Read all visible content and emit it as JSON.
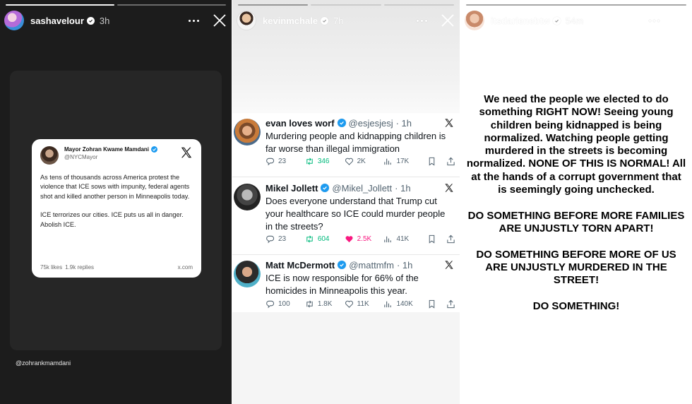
{
  "stories": [
    {
      "username": "sashavelour",
      "time": "3h",
      "embed": {
        "name": "Mayor Zohran Kwame Mamdani",
        "handle": "@NYCMayor",
        "paragraph1": "As tens of thousands across America protest the violence that ICE sows with impunity, federal agents shot and killed another person in Minneapolis today.",
        "paragraph2": "ICE terrorizes our cities. ICE puts us all in danger. Abolish ICE.",
        "likes": "75k likes",
        "replies": "1.9k replies",
        "domain": "x.com"
      },
      "mention": "@zohrankmamdani"
    },
    {
      "username": "kevinmchale",
      "time": "7h",
      "tweets": [
        {
          "name": "evan loves worf",
          "handle": "@esjesjesj",
          "time": "· 1h",
          "text": "Murdering people and kidnapping children is far worse than illegal immigration",
          "replies": "23",
          "retweets": "346",
          "likes": "2K",
          "views": "17K"
        },
        {
          "name": "Mikel Jollett",
          "handle": "@Mikel_Jollett",
          "time": "· 1h",
          "text": "Does everyone understand that Trump cut your healthcare so ICE could murder people in the streets?",
          "replies": "23",
          "retweets": "604",
          "likes": "2.5K",
          "views": "41K"
        },
        {
          "name": "Matt McDermott",
          "handle": "@mattmfm",
          "time": "· 1h",
          "text": "ICE is now responsible for 66% of the homicides in Minneapolis this year.",
          "replies": "100",
          "retweets": "1.8K",
          "likes": "11K",
          "views": "140K"
        }
      ]
    },
    {
      "username": "itsdarlenebtw",
      "time": "54m",
      "paragraphs": [
        "We need the people we elected to do something RIGHT NOW! Seeing young children being kidnapped is being normalized. Watching people getting murdered in the streets is becoming normalized. NONE OF THIS IS NORMAL! All at the hands of a corrupt government that is seemingly going unchecked.",
        "DO SOMETHING BEFORE MORE FAMILIES ARE UNJUSTLY TORN APART!",
        "DO SOMETHING BEFORE MORE OF US ARE UNJUSTLY MURDERED IN THE STREET!",
        "DO SOMETHING!"
      ]
    }
  ],
  "colors": {
    "dark_bg": "#1c1c1c",
    "verified_blue": "#1d9bf0",
    "retweet_green": "#00ba7c",
    "like_pink": "#f91880"
  },
  "icons": [
    "verified-icon",
    "more-icon",
    "close-icon",
    "x-logo-icon",
    "reply-icon",
    "retweet-icon",
    "like-icon",
    "views-icon",
    "bookmark-icon",
    "share-icon"
  ]
}
